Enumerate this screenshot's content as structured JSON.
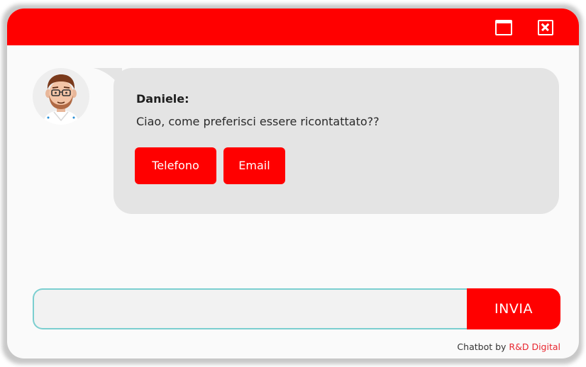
{
  "window": {
    "header_color": "#ff0000",
    "maximize_icon": "maximize-icon",
    "close_icon": "close-icon"
  },
  "message": {
    "avatar_icon": "agent-avatar",
    "sender": "Daniele:",
    "text": "Ciao, come preferisci essere ricontattato??",
    "options": [
      {
        "label": "Telefono"
      },
      {
        "label": "Email"
      }
    ]
  },
  "composer": {
    "input_value": "",
    "send_label": "INVIA"
  },
  "footer": {
    "prefix": "Chatbot by",
    "brand": "R&D Digital"
  },
  "colors": {
    "accent": "#ff0000",
    "bubble": "#e4e4e4",
    "input_border": "#7ccfd0",
    "brand_link": "#e8262f"
  }
}
